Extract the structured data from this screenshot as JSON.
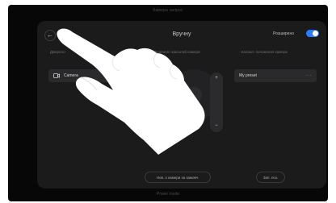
{
  "device": {
    "top_caption": "Камера запрос",
    "bottom_caption": "Power mode"
  },
  "header": {
    "back_icon": "arrow-left-icon",
    "title": "Вручну",
    "advanced_label": "Розширено",
    "toggle_on": true,
    "toggle_color": "#2f7bf6"
  },
  "sections": {
    "source_label": "Джерело",
    "control_label": "Наведення і масштаб камери",
    "presets_label": "Налашт. положення камери"
  },
  "camera": {
    "icon": "camera-icon",
    "label": "Camera"
  },
  "zoom": {
    "plus_label": "+",
    "minus_label": "−"
  },
  "preset": {
    "label": "My preset",
    "more_label": "···"
  },
  "footer": {
    "left_button": "Нов. о камери за замовч.",
    "right_button": "Зап. поз."
  }
}
